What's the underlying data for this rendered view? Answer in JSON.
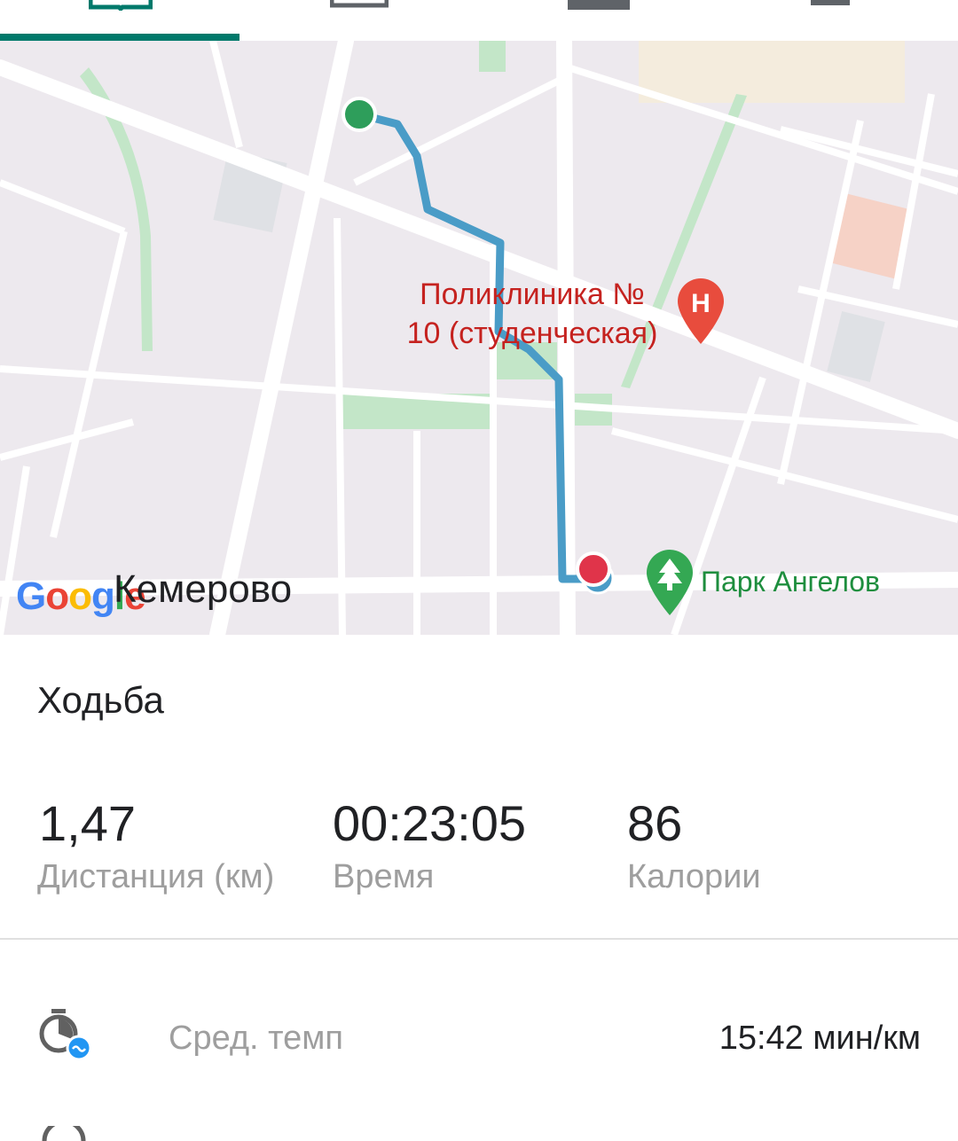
{
  "map": {
    "city_label": "Кемерово",
    "hospital_label_line1": "Поликлиника №",
    "hospital_label_line2": "10 (студенческая)",
    "park_label": "Парк Ангелов",
    "google_letters": [
      "G",
      "o",
      "o",
      "g",
      "l",
      "e"
    ],
    "colors": {
      "route": "#4a9cc7",
      "start": "#2e9e5b",
      "end": "#e0344a",
      "park": "#1e8e3e",
      "hospital": "#e84c3d"
    }
  },
  "activity": {
    "title": "Ходьба",
    "stats": [
      {
        "value": "1,47",
        "label": "Дистанция (км)"
      },
      {
        "value": "00:23:05",
        "label": "Время"
      },
      {
        "value": "86",
        "label": "Калории"
      }
    ]
  },
  "details": [
    {
      "label": "Сред. темп",
      "value": "15:42 мин/км",
      "icon": "pace-icon"
    }
  ],
  "tabs": {
    "icons": [
      "book-icon",
      "calendar-icon",
      "tab-icon",
      "menu-icon"
    ],
    "accent": "#00796b"
  }
}
